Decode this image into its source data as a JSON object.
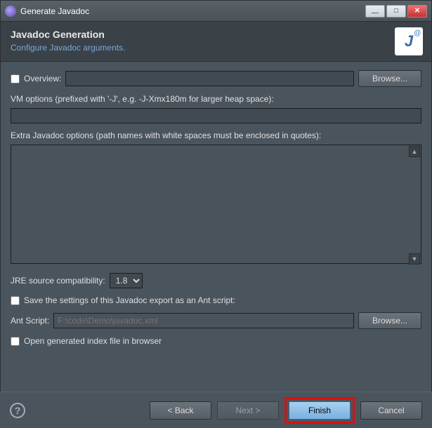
{
  "titlebar": {
    "title": "Generate Javadoc"
  },
  "header": {
    "title": "Javadoc Generation",
    "subtitle": "Configure Javadoc arguments."
  },
  "overview": {
    "label": "Overview:",
    "value": "",
    "browse": "Browse..."
  },
  "vm": {
    "label": "VM options (prefixed with '-J', e.g. -J-Xmx180m for larger heap space):",
    "value": ""
  },
  "extra": {
    "label": "Extra Javadoc options (path names with white spaces must be enclosed in quotes):",
    "value": ""
  },
  "jre": {
    "label": "JRE source compatibility:",
    "value": "1.8"
  },
  "saveAnt": {
    "label": "Save the settings of this Javadoc export as an Ant script:"
  },
  "antScript": {
    "label": "Ant Script:",
    "placeholder": "F:\\code\\Demo\\javadoc.xml",
    "browse": "Browse..."
  },
  "openIndex": {
    "label": "Open generated index file in browser"
  },
  "buttons": {
    "back": "< Back",
    "next": "Next >",
    "finish": "Finish",
    "cancel": "Cancel"
  },
  "help": {
    "q": "?"
  },
  "icon": {
    "letter": "J",
    "at": "@"
  }
}
